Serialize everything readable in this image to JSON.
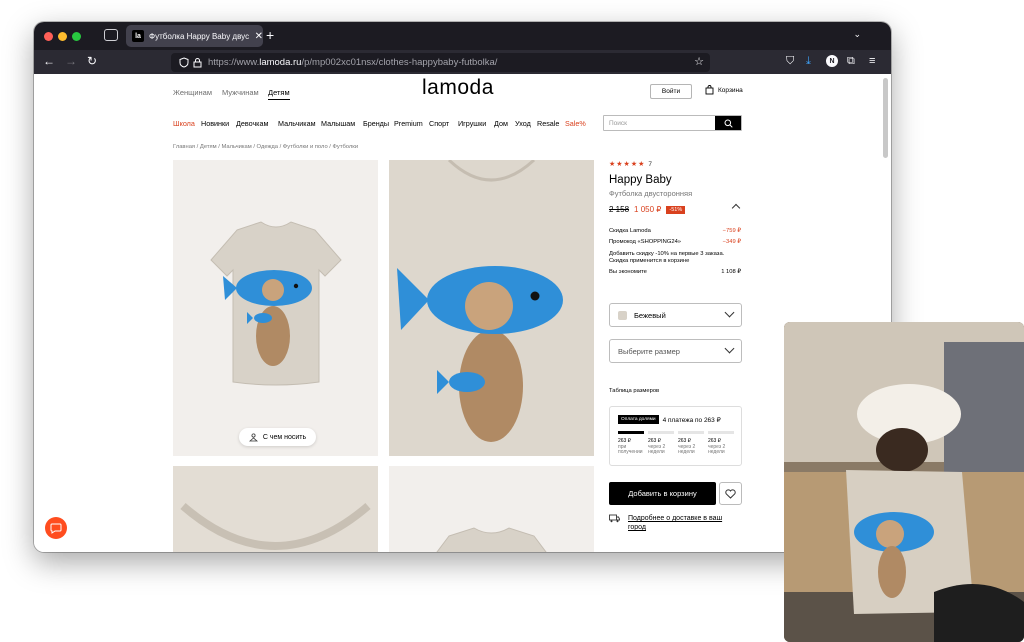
{
  "browser": {
    "tab_title": "Футболка Happy Baby двустор",
    "favicon_text": "la",
    "url_prefix": "https://www.",
    "url_domain": "lamoda.ru",
    "url_path": "/p/mp002xc01nsx/clothes-happybaby-futbolka/"
  },
  "header": {
    "gender_links": [
      "Женщинам",
      "Мужчинам",
      "Детям"
    ],
    "logo": "lamoda",
    "login_label": "Войти",
    "cart_label": "Корзина"
  },
  "categories": [
    "Школа",
    "Новинки",
    "Девочкам",
    "Мальчикам",
    "Малышам",
    "Бренды",
    "Premium",
    "Спорт",
    "Игрушки",
    "Дом",
    "Уход",
    "Resale",
    "Sale%"
  ],
  "search": {
    "placeholder": "Поиск"
  },
  "breadcrumb": "Главная  /  Детям  /  Мальчикам  /  Одежда  /  Футболки и поло  /  Футболки",
  "gallery": {
    "outfit_label": "С чем носить"
  },
  "product": {
    "stars": "★★★★★",
    "rating_count": "7",
    "brand": "Happy Baby",
    "type": "Футболка двусторонняя",
    "old_price": "2 158",
    "new_price": "1 050 ₽",
    "discount_badge": "-51%",
    "discounts": [
      {
        "label": "Скидка Lamoda",
        "value": "−759 ₽"
      },
      {
        "label": "Промокод «SHOPPING24»",
        "value": "−349 ₽"
      }
    ],
    "note": "Добавить скидку -10% на первые 3 заказа. Скидка применится в корзине",
    "savings_label": "Вы экономите",
    "savings_value": "1 108 ₽",
    "color": "Бежевый",
    "size_placeholder": "Выберите размер",
    "size_table": "Таблица размеров",
    "split_badge": "Оплата долями",
    "split_text": "4 платежа по 263 ₽",
    "installments": [
      {
        "amount": "263 ₽",
        "when": "при получении"
      },
      {
        "amount": "263 ₽",
        "when": "через 2 недели"
      },
      {
        "amount": "263 ₽",
        "when": "через 2 недели"
      },
      {
        "amount": "263 ₽",
        "when": "через 2 недели"
      }
    ],
    "installments_paid": 1,
    "add_to_cart": "Добавить в корзину",
    "delivery_link": "Подробнее о доставке в ваш город"
  },
  "colors": {
    "accent": "#d9411e",
    "shirt": "#d8d2c8",
    "fish": "#2f8fd8"
  }
}
